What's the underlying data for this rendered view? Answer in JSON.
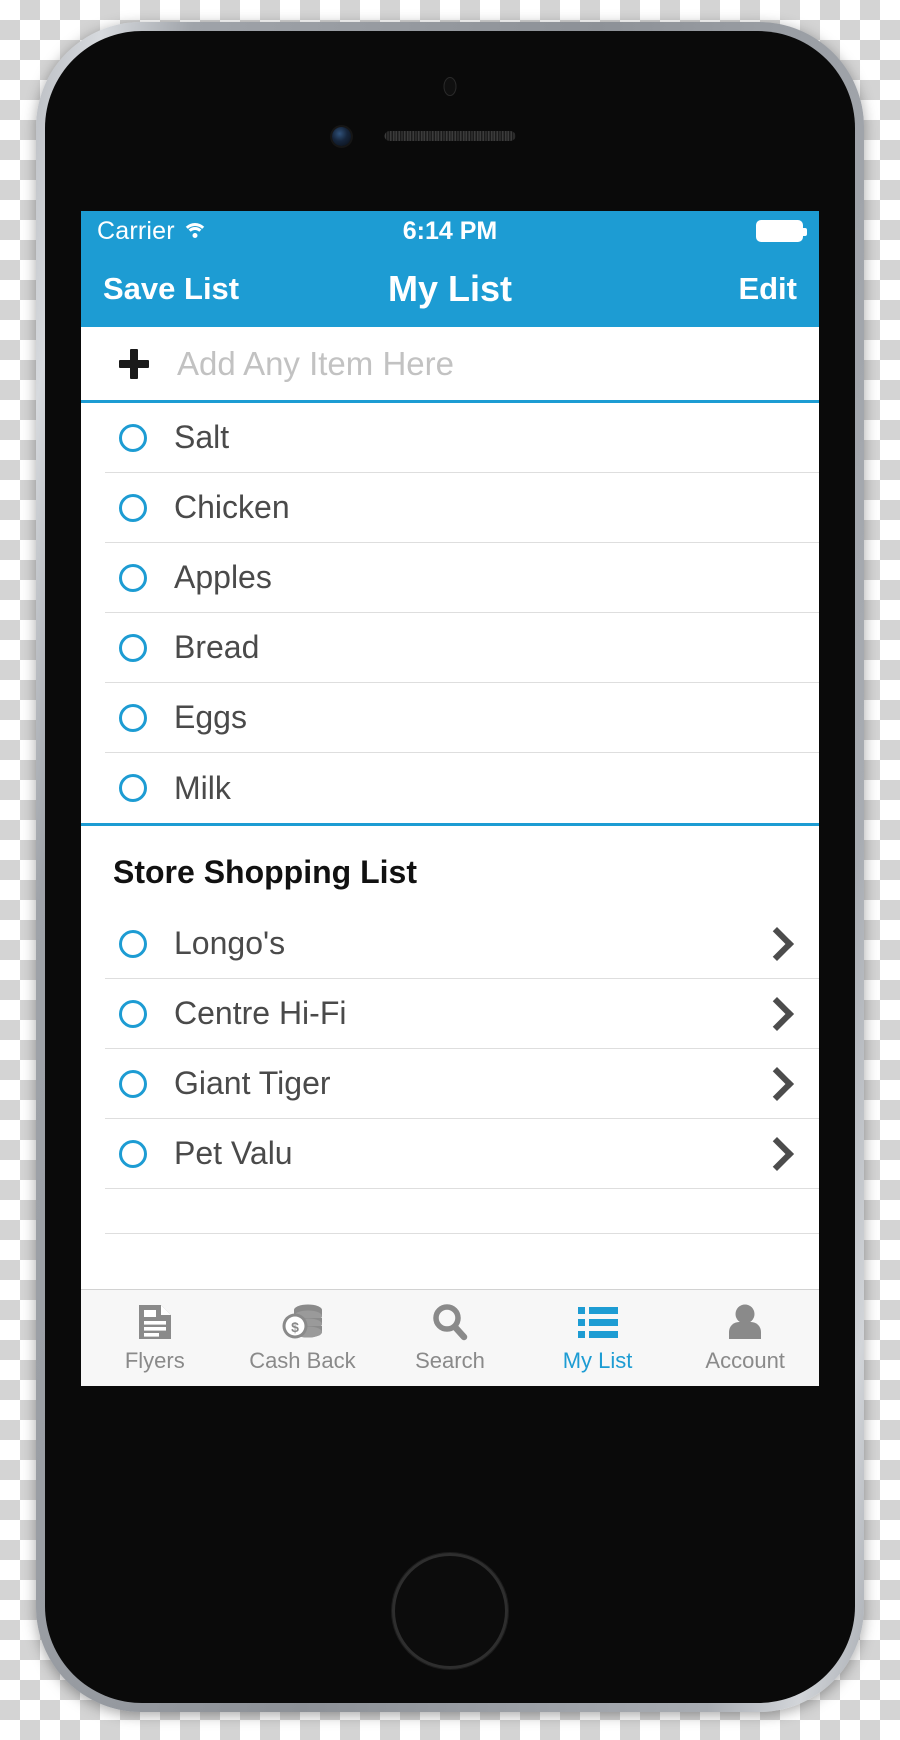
{
  "status_bar": {
    "carrier": "Carrier",
    "wifi_icon": "wifi-icon",
    "time": "6:14 PM",
    "battery_icon": "battery-full-icon"
  },
  "nav_bar": {
    "left_button": "Save List",
    "title": "My List",
    "right_button": "Edit"
  },
  "add_item": {
    "plus_icon": "plus-icon",
    "placeholder": "Add Any Item Here",
    "value": ""
  },
  "my_items": [
    {
      "label": "Salt",
      "checked": false
    },
    {
      "label": "Chicken",
      "checked": false
    },
    {
      "label": "Apples",
      "checked": false
    },
    {
      "label": "Bread",
      "checked": false
    },
    {
      "label": "Eggs",
      "checked": false
    },
    {
      "label": "Milk",
      "checked": false
    }
  ],
  "store_section": {
    "title": "Store Shopping List",
    "stores": [
      {
        "label": "Longo's",
        "checked": false,
        "chevron": "chevron-right-icon"
      },
      {
        "label": "Centre Hi-Fi",
        "checked": false,
        "chevron": "chevron-right-icon"
      },
      {
        "label": "Giant Tiger",
        "checked": false,
        "chevron": "chevron-right-icon"
      },
      {
        "label": "Pet Valu",
        "checked": false,
        "chevron": "chevron-right-icon"
      }
    ]
  },
  "tab_bar": {
    "tabs": [
      {
        "label": "Flyers",
        "icon": "document-icon",
        "active": false
      },
      {
        "label": "Cash Back",
        "icon": "coins-icon",
        "active": false
      },
      {
        "label": "Search",
        "icon": "search-icon",
        "active": false
      },
      {
        "label": "My List",
        "icon": "list-icon",
        "active": true
      },
      {
        "label": "Account",
        "icon": "person-icon",
        "active": false
      }
    ]
  },
  "colors": {
    "accent": "#1d9cd3",
    "tab_inactive": "#8a8a8a",
    "text": "#4a4a4a",
    "separator": "#dedede"
  }
}
